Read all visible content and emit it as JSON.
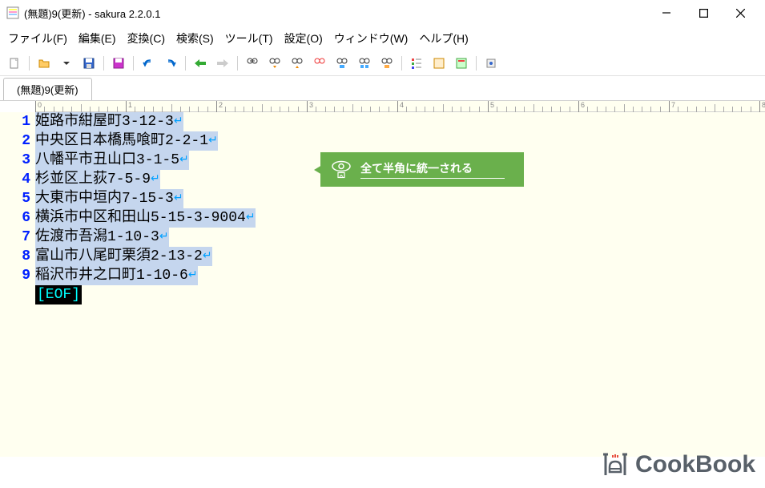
{
  "title": "(無題)9(更新) - sakura 2.2.0.1",
  "menu": {
    "file": "ファイル(F)",
    "edit": "編集(E)",
    "convert": "変換(C)",
    "search": "検索(S)",
    "tool": "ツール(T)",
    "setting": "設定(O)",
    "window": "ウィンドウ(W)",
    "help": "ヘルプ(H)"
  },
  "tab": "(無題)9(更新)",
  "ruler": [
    "0",
    "1",
    "2",
    "3",
    "4",
    "5",
    "6",
    "7",
    "8"
  ],
  "lines": [
    {
      "n": "1",
      "t": "姫路市紺屋町3-12-3"
    },
    {
      "n": "2",
      "t": "中央区日本橋馬喰町2-2-1"
    },
    {
      "n": "3",
      "t": "八幡平市丑山口3-1-5"
    },
    {
      "n": "4",
      "t": "杉並区上荻7-5-9"
    },
    {
      "n": "5",
      "t": "大東市中垣内7-15-3"
    },
    {
      "n": "6",
      "t": "横浜市中区和田山5-15-3-9004"
    },
    {
      "n": "7",
      "t": "佐渡市吾潟1-10-3"
    },
    {
      "n": "8",
      "t": "富山市八尾町栗須2-13-2"
    },
    {
      "n": "9",
      "t": "稲沢市井之口町1-10-6"
    }
  ],
  "eof": "[EOF]",
  "annotation": "全て半角に統一される",
  "watermark": "CookBook"
}
